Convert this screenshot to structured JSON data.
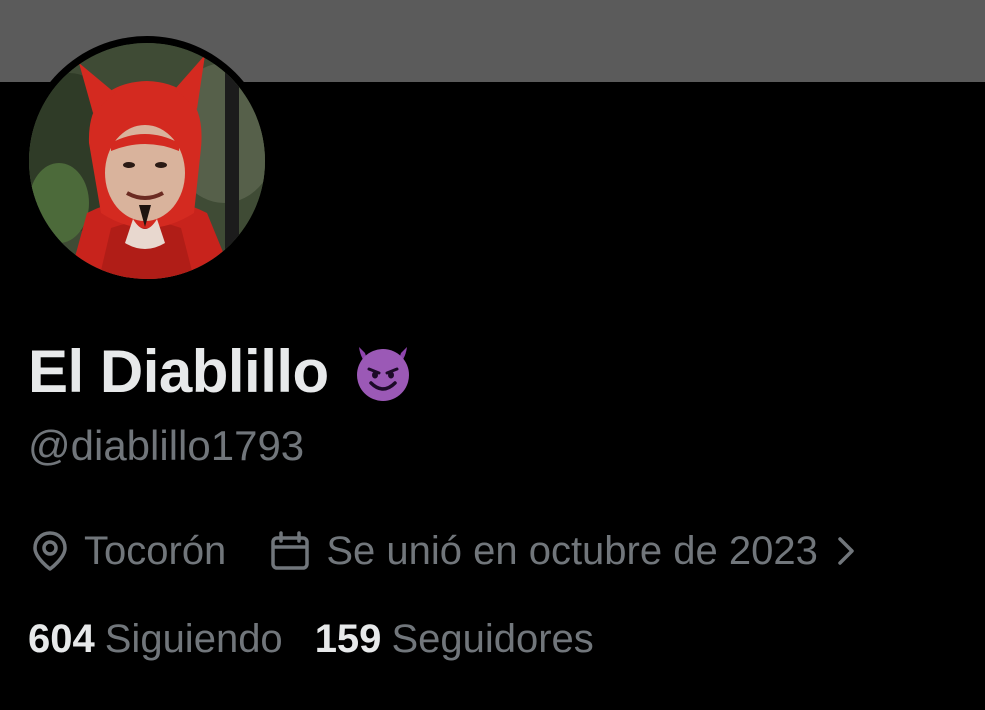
{
  "profile": {
    "display_name": "El Diablillo",
    "name_emoji": "smiling-face-with-horns",
    "handle": "@diablillo1793",
    "avatar": "devil-costume-child-photo",
    "location": {
      "icon": "location-pin-icon",
      "label": "Tocorón"
    },
    "joined": {
      "icon": "calendar-icon",
      "label": "Se unió en octubre de 2023"
    },
    "stats": {
      "following_count": "604",
      "following_label": "Siguiendo",
      "followers_count": "159",
      "followers_label": "Seguidores"
    }
  },
  "colors": {
    "background": "#000000",
    "banner": "#5b5b5b",
    "primary_text": "#e7e9ea",
    "secondary_text": "#71767b",
    "emoji_purple": "#8e44ad"
  }
}
